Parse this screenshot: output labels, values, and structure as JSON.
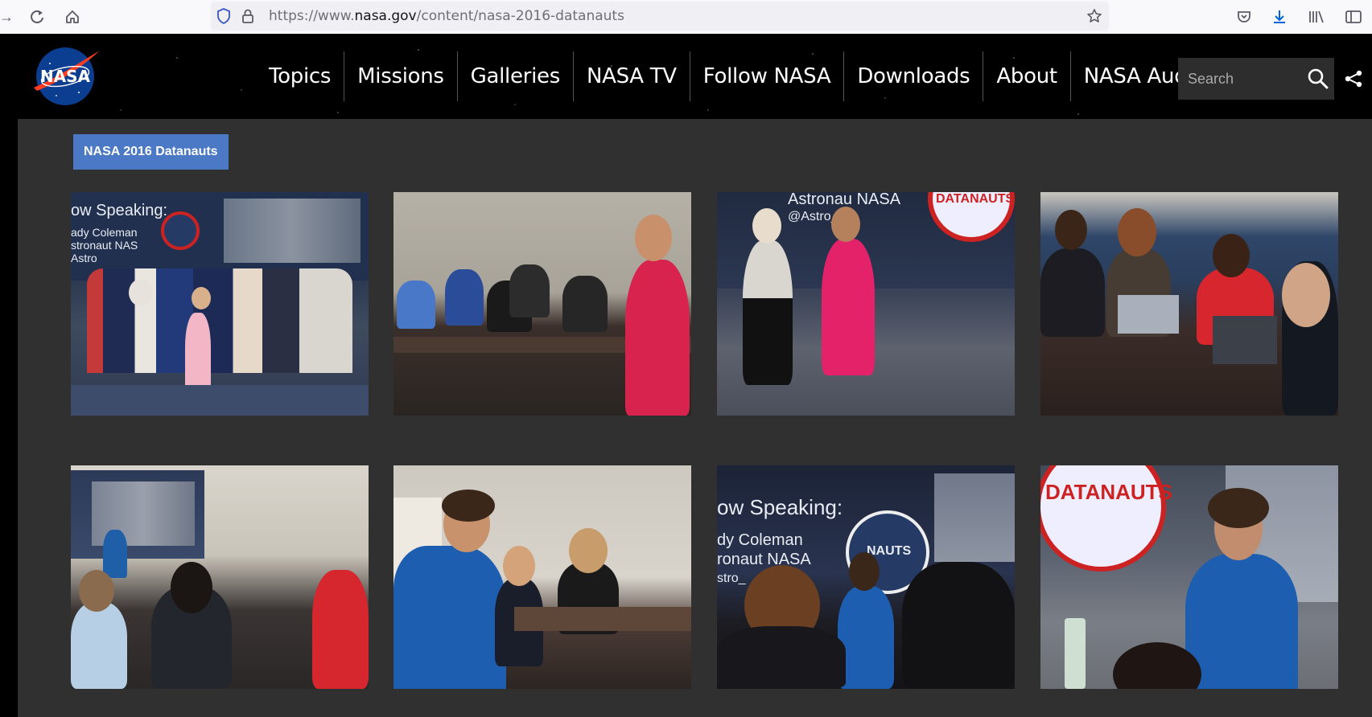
{
  "browser": {
    "url_prefix": "https://www.",
    "url_host": "nasa.gov",
    "url_path": "/content/nasa-2016-datanauts"
  },
  "header": {
    "logo_text": "NASA",
    "nav": [
      "Topics",
      "Missions",
      "Galleries",
      "NASA TV",
      "Follow NASA",
      "Downloads",
      "About",
      "NASA Audiences"
    ],
    "search_placeholder": "Search"
  },
  "gallery": {
    "album_title": "NASA 2016 Datanauts",
    "photos": [
      {
        "overlay": [
          "ow Speaking:",
          "ady Coleman",
          "stronaut NAS",
          "Astro"
        ]
      },
      {
        "overlay": []
      },
      {
        "overlay": [
          "Astronau NASA",
          "@Astro_Ca"
        ],
        "patch_text": "DATANAUTS"
      },
      {
        "overlay": []
      },
      {
        "overlay": []
      },
      {
        "overlay": []
      },
      {
        "overlay": [
          "ow Speaking:",
          "dy Coleman",
          "ronaut NASA",
          "stro_"
        ],
        "patch_text": "NAUTS"
      },
      {
        "overlay": [],
        "patch_text": "DATANAUTS"
      }
    ]
  },
  "colors": {
    "album_tag": "#4c79c6",
    "page_bg": "#303030",
    "header_bg": "#000000"
  }
}
